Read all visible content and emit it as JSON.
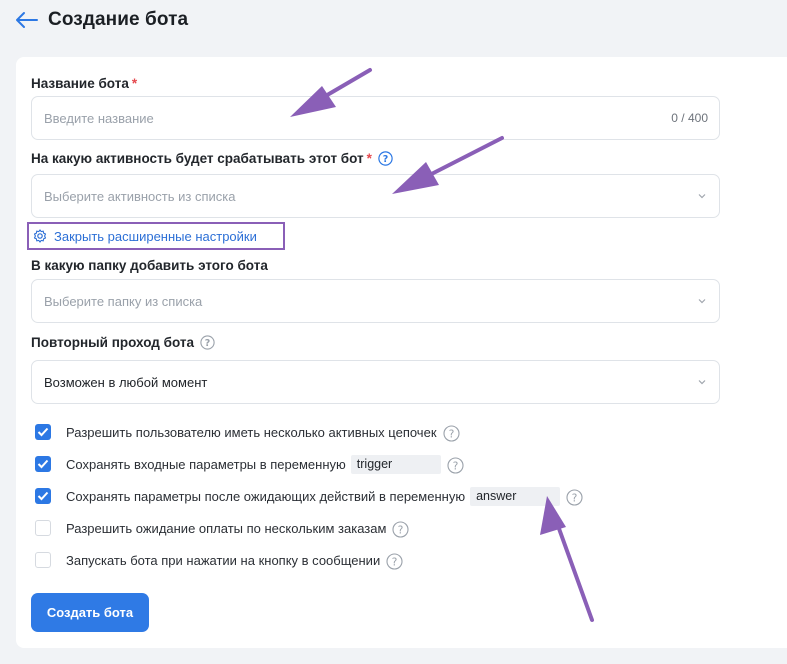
{
  "header": {
    "title": "Создание бота"
  },
  "form": {
    "name": {
      "label": "Название бота",
      "required_mark": "*",
      "placeholder": "Введите название",
      "counter": "0 / 400"
    },
    "activity": {
      "label": "На какую активность будет срабатывать этот бот",
      "required_mark": "*",
      "placeholder": "Выберите активность из списка"
    },
    "advanced_toggle": "Закрыть расширенные настройки",
    "folder": {
      "label": "В какую папку добавить этого бота",
      "placeholder": "Выберите папку из списка"
    },
    "repeat": {
      "label": "Повторный проход бота",
      "value": "Возможен в любой момент"
    },
    "options": [
      {
        "label": "Разрешить пользователю иметь несколько активных цепочек",
        "checked": true
      },
      {
        "label": "Сохранять входные параметры в переменную",
        "checked": true,
        "variable": "trigger"
      },
      {
        "label": "Сохранять параметры после ожидающих действий в переменную",
        "checked": true,
        "variable": "answer"
      },
      {
        "label": "Разрешить ожидание оплаты по нескольким заказам",
        "checked": false
      },
      {
        "label": "Запускать бота при нажатии на кнопку в сообщении",
        "checked": false
      }
    ],
    "submit_label": "Создать бота"
  },
  "colors": {
    "accent": "#2f7ae5",
    "annotation": "#8a5fb7",
    "required": "#e5484d"
  }
}
